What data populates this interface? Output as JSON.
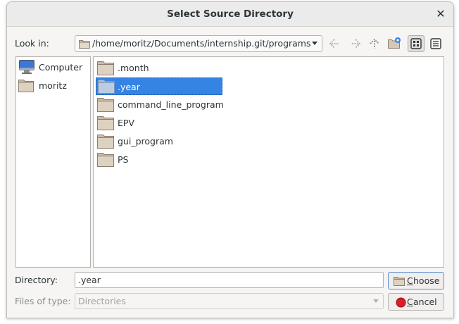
{
  "window": {
    "title": "Select Source Directory",
    "close_label": "✕"
  },
  "look_in": {
    "label": "Look in:",
    "path": "/home/moritz/Documents/internship.git/programs"
  },
  "toolbar": {
    "buttons": [
      "back-icon",
      "forward-icon",
      "parent-directory-icon",
      "new-folder-icon",
      "icon-view-icon",
      "detail-view-icon"
    ]
  },
  "sidebar": {
    "places": [
      {
        "label": "Computer",
        "icon": "computer-icon"
      },
      {
        "label": "moritz",
        "icon": "folder-icon"
      }
    ]
  },
  "files": {
    "items": [
      {
        "name": ".month",
        "selected": false
      },
      {
        "name": ".year",
        "selected": true
      },
      {
        "name": "command_line_program",
        "selected": false
      },
      {
        "name": "EPV",
        "selected": false
      },
      {
        "name": "gui_program",
        "selected": false
      },
      {
        "name": "PS",
        "selected": false
      }
    ]
  },
  "directory": {
    "label": "Directory:",
    "value": ".year"
  },
  "files_of_type": {
    "label": "Files of type:",
    "value": "Directories"
  },
  "buttons": {
    "choose_mnemonic": "C",
    "choose_rest": "hoose",
    "cancel_mnemonic": "C",
    "cancel_rest": "ancel"
  },
  "colors": {
    "selection": "#3584e4",
    "folder": "#d5c8b4",
    "cancel_icon": "#e01b24"
  }
}
